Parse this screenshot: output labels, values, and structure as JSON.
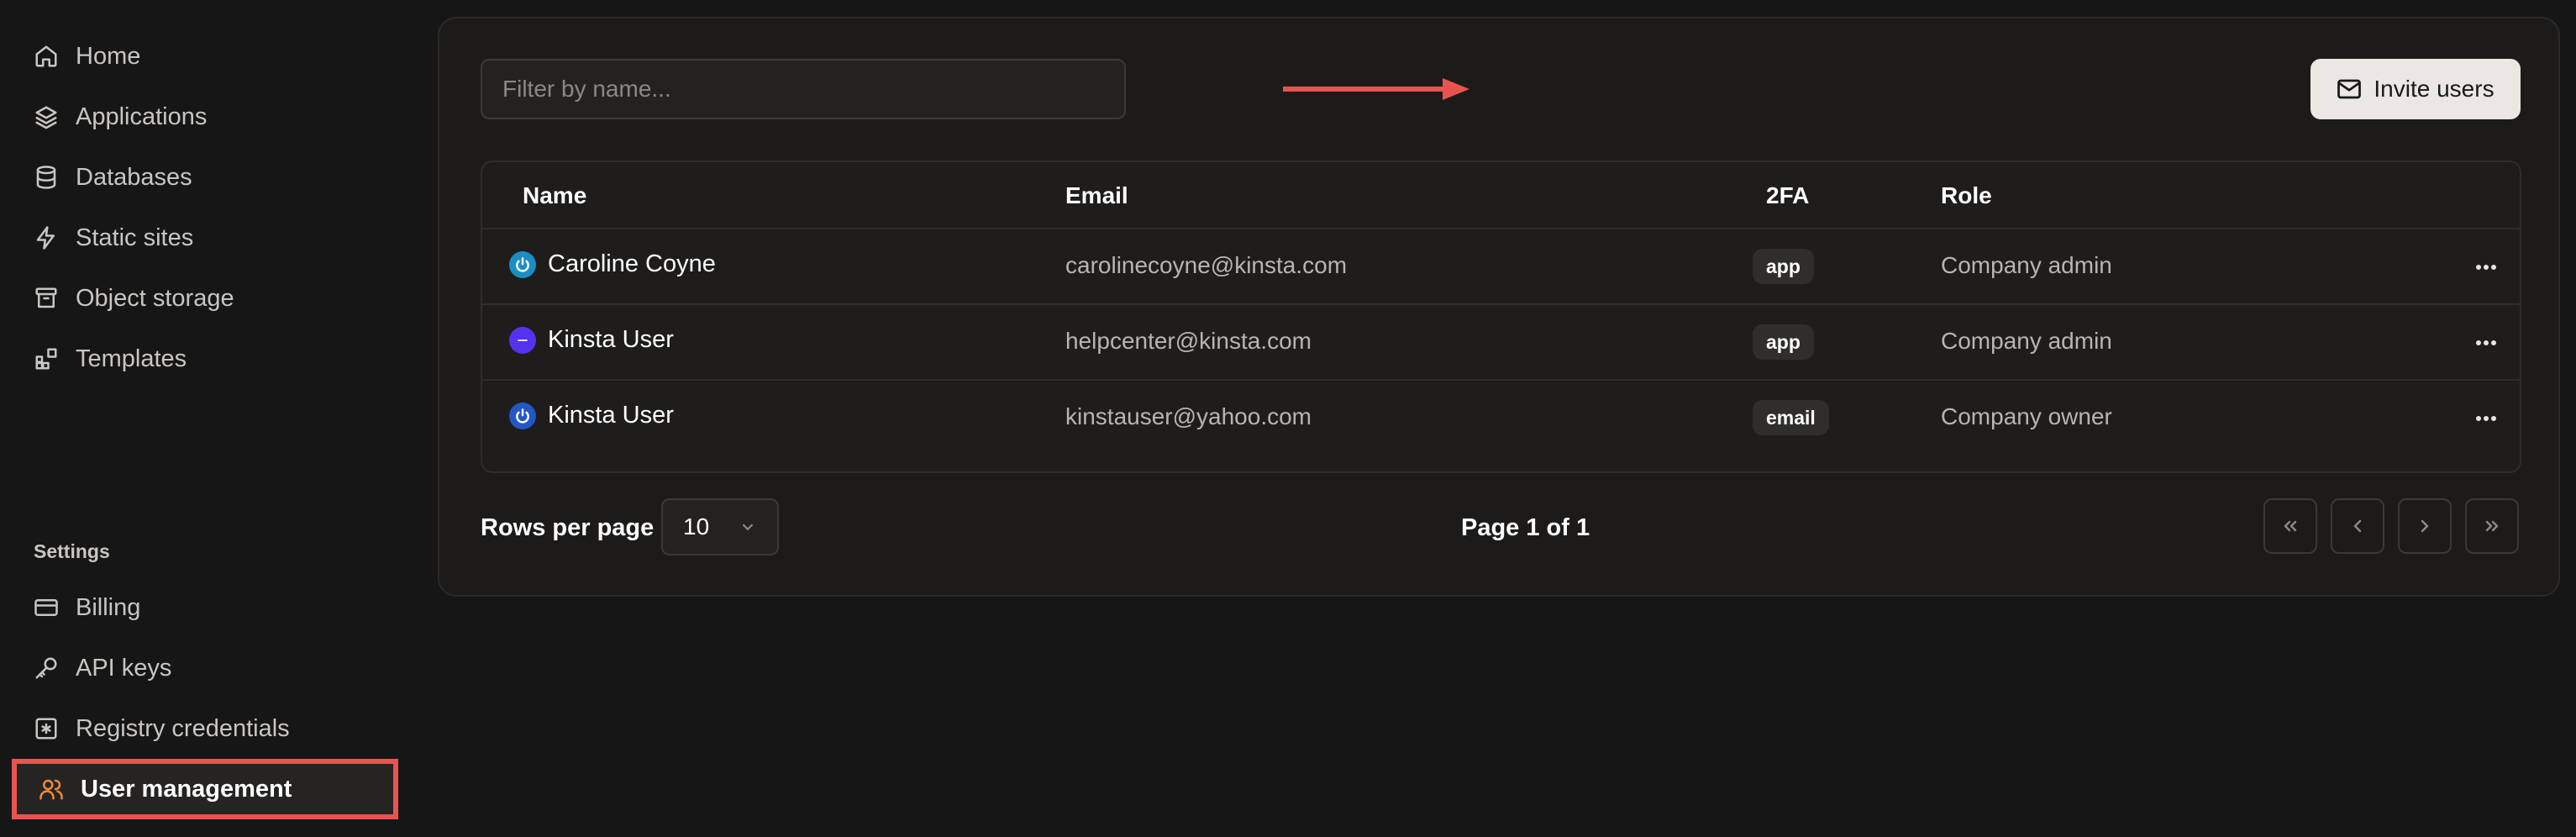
{
  "sidebar": {
    "items": [
      {
        "label": "Home",
        "icon": "home-icon"
      },
      {
        "label": "Applications",
        "icon": "layers-icon"
      },
      {
        "label": "Databases",
        "icon": "database-icon"
      },
      {
        "label": "Static sites",
        "icon": "bolt-icon"
      },
      {
        "label": "Object storage",
        "icon": "archive-icon"
      },
      {
        "label": "Templates",
        "icon": "grid-icon"
      }
    ],
    "settings_label": "Settings",
    "settings_items": [
      {
        "label": "Billing",
        "icon": "credit-card-icon"
      },
      {
        "label": "API keys",
        "icon": "key-icon"
      },
      {
        "label": "Registry credentials",
        "icon": "asterisk-square-icon"
      },
      {
        "label": "User management",
        "icon": "users-icon",
        "active": true
      }
    ]
  },
  "toolbar": {
    "filter_placeholder": "Filter by name...",
    "invite_label": "Invite users"
  },
  "table": {
    "columns": [
      "Name",
      "Email",
      "2FA",
      "Role"
    ],
    "rows": [
      {
        "name": "Caroline Coyne",
        "email": "carolinecoyne@kinsta.com",
        "twofa": "app",
        "role": "Company admin",
        "avatar": "power-icon",
        "avatar_color": "#1b8ec4"
      },
      {
        "name": "Kinsta User",
        "email": "helpcenter@kinsta.com",
        "twofa": "app",
        "role": "Company admin",
        "avatar": "kinsta-logo-icon",
        "avatar_color": "#5333ed"
      },
      {
        "name": "Kinsta User",
        "email": "kinstauser@yahoo.com",
        "twofa": "email",
        "role": "Company owner",
        "avatar": "power-icon",
        "avatar_color": "#2257c7"
      }
    ]
  },
  "pagination": {
    "rows_per_page_label": "Rows per page",
    "rows_per_page_value": "10",
    "page_info": "Page 1 of 1"
  },
  "colors": {
    "accent_highlight": "#e9534f",
    "active_icon": "#f08a3c"
  }
}
